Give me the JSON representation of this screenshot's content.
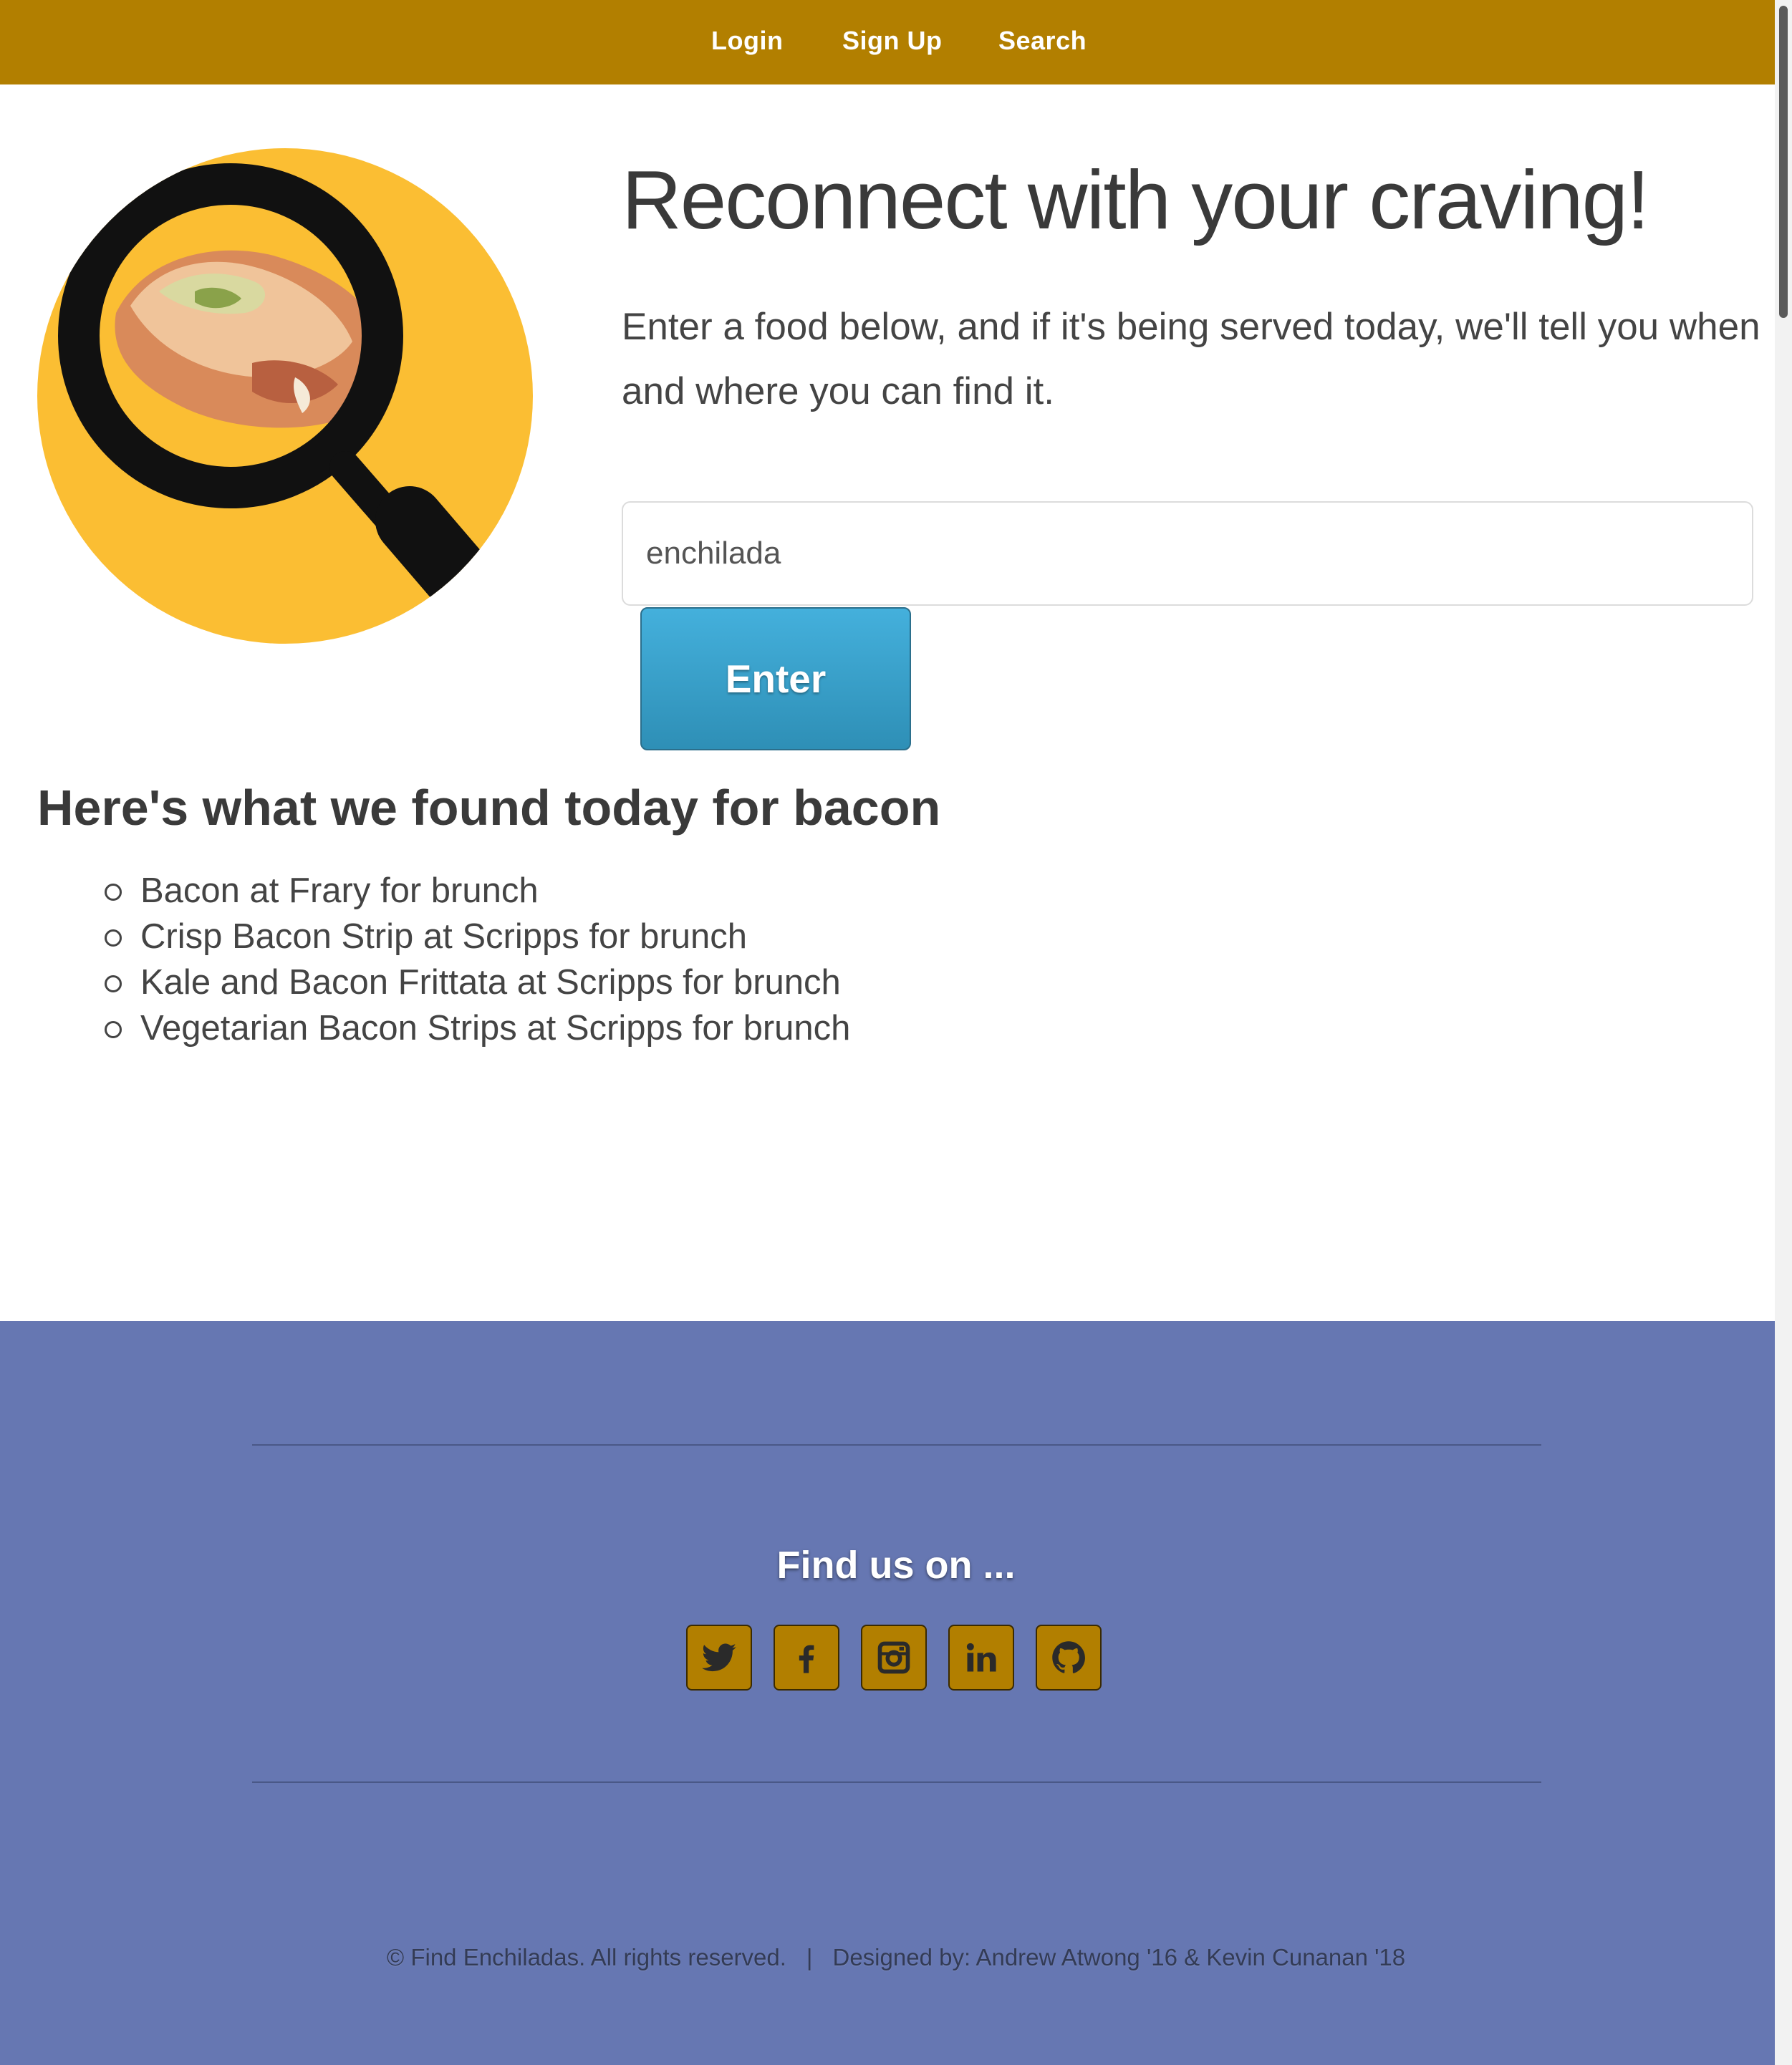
{
  "nav": {
    "login": "Login",
    "signup": "Sign Up",
    "search": "Search"
  },
  "hero": {
    "headline": "Reconnect with your craving!",
    "subtext": "Enter a food below, and if it's being served today, we'll tell you when and where you can find it.",
    "input_value": "enchilada",
    "enter_label": "Enter"
  },
  "results": {
    "heading": "Here's what we found today for bacon",
    "items": [
      "Bacon at Frary for brunch",
      "Crisp Bacon Strip at Scripps for brunch",
      "Kale and Bacon Frittata at Scripps for brunch",
      "Vegetarian Bacon Strips at Scripps for brunch"
    ]
  },
  "footer": {
    "find_us": "Find us on ...",
    "social": [
      "twitter-icon",
      "facebook-icon",
      "instagram-icon",
      "linkedin-icon",
      "github-icon"
    ],
    "copyright": "© Find Enchiladas. All rights reserved.",
    "separator": "|",
    "designed_by": "Designed by: Andrew Atwong '16 & Kevin Cunanan '18"
  },
  "colors": {
    "nav_bg": "#b27f00",
    "footer_bg": "#6677b2",
    "logo_circle": "#fbbe33",
    "button_blue": "#3aa0cc"
  }
}
